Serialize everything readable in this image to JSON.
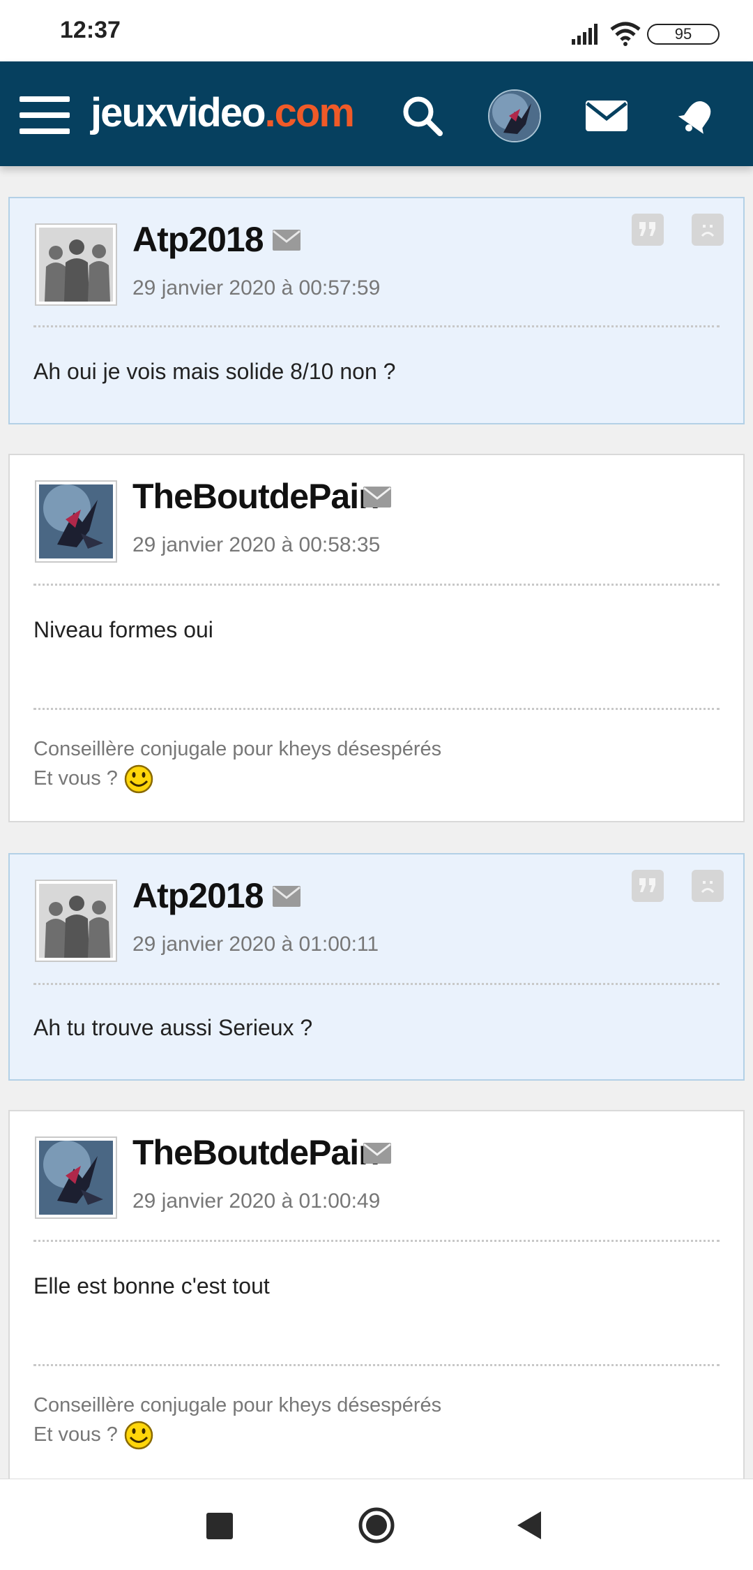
{
  "status_bar": {
    "time": "12:37",
    "battery": "95"
  },
  "header": {
    "logo_main": "jeuxvideo",
    "logo_dot": ".com"
  },
  "posts": [
    {
      "author": "Atp2018",
      "date": "29 janvier 2020 à 00:57:59",
      "message": "Ah oui je vois mais solide 8/10 non ?",
      "highlight": true
    },
    {
      "author": "TheBoutdePain",
      "date": "29 janvier 2020 à 00:58:35",
      "message": "Niveau formes oui",
      "signature_line1": "Conseillère conjugale pour kheys désespérés",
      "signature_line2": "Et vous ?"
    },
    {
      "author": "Atp2018",
      "date": "29 janvier 2020 à 01:00:11",
      "message": "Ah tu trouve aussi Serieux ?",
      "highlight": true
    },
    {
      "author": "TheBoutdePain",
      "date": "29 janvier 2020 à 01:00:49",
      "message": "Elle est bonne c'est tout",
      "signature_line1": "Conseillère conjugale pour kheys désespérés",
      "signature_line2": "Et vous ?"
    }
  ],
  "icons": {
    "menu": "hamburger-icon",
    "search": "search-icon",
    "messages": "envelope-icon",
    "notifications": "bell-icon",
    "quote": "quote-icon",
    "report": "sad-face-icon",
    "private_message": "envelope-icon",
    "smiley": "smiley-icon"
  },
  "colors": {
    "header_bg": "#06405f",
    "logo_accent": "#f05a28",
    "highlight_bg": "#eaf2fc"
  }
}
